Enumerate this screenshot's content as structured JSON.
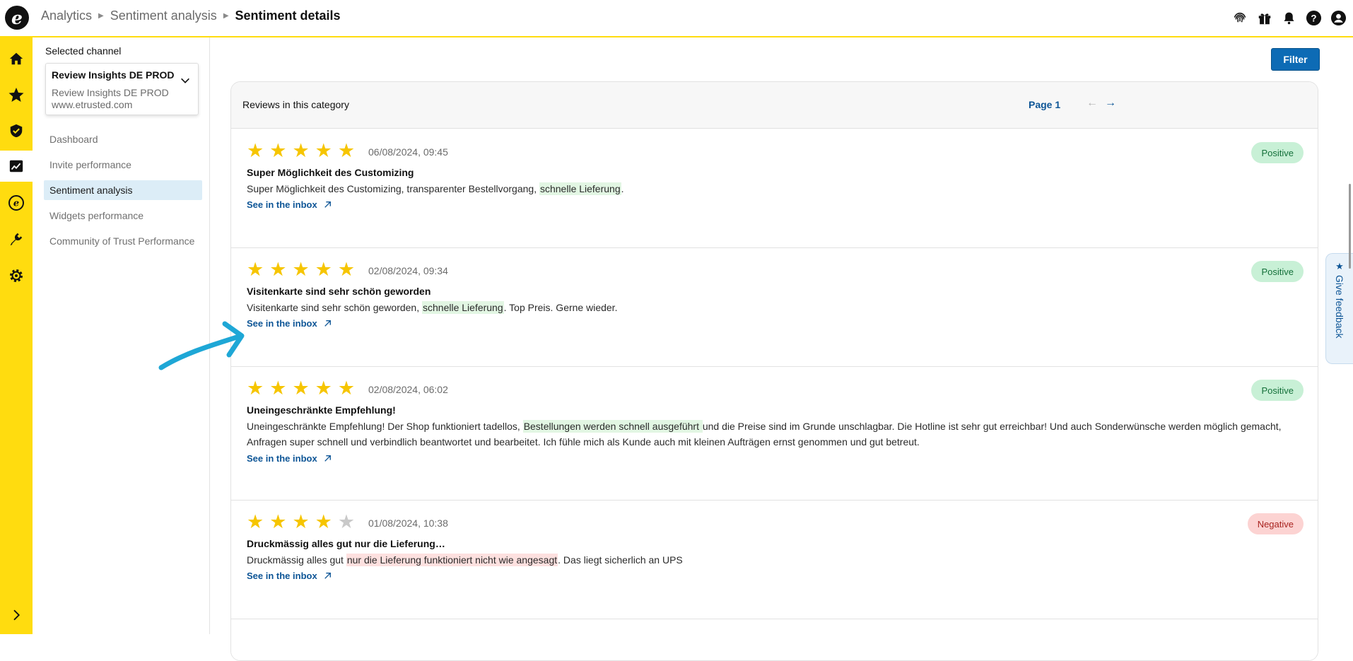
{
  "header": {
    "logo_letter": "e",
    "breadcrumb": [
      "Analytics",
      "Sentiment analysis",
      "Sentiment details"
    ],
    "icons": [
      "fingerprint-icon",
      "gift-icon",
      "bell-icon",
      "help-icon",
      "user-icon"
    ]
  },
  "rail": {
    "icons": [
      "home-icon",
      "star-icon",
      "shield-check-icon",
      "analytics-chart-icon",
      "etrusted-logo-icon",
      "plug-icon",
      "gear-icon"
    ],
    "active": "analytics-chart-icon",
    "expand_icon": "chevron-right-icon"
  },
  "sidebar": {
    "selected_channel_label": "Selected channel",
    "channel": {
      "name": "Review Insights DE PROD",
      "sub_name": "Review Insights DE PROD",
      "domain": "www.etrusted.com"
    },
    "nav": [
      {
        "label": "Dashboard"
      },
      {
        "label": "Invite performance"
      },
      {
        "label": "Sentiment analysis",
        "active": true
      },
      {
        "label": "Widgets performance"
      },
      {
        "label": "Community of Trust Performance"
      }
    ]
  },
  "main": {
    "filter_label": "Filter",
    "card_title": "Reviews in this category",
    "page_label": "Page 1",
    "prev_arrow": "←",
    "next_arrow": "→",
    "link_label": "See in the inbox",
    "reviews": [
      {
        "rating": 5,
        "date": "06/08/2024, 09:45",
        "title": "Super Möglichkeit des Customizing",
        "body_before": "Super Möglichkeit des Customizing, transparenter Bestellvorgang, ",
        "highlight": "schnelle Lieferung",
        "body_after": ".",
        "sentiment": "Positive"
      },
      {
        "rating": 5,
        "date": "02/08/2024, 09:34",
        "title": "Visitenkarte sind sehr schön geworden",
        "body_before": "Visitenkarte sind sehr schön geworden, ",
        "highlight": "schnelle Lieferung",
        "body_after": ". Top Preis. Gerne wieder.",
        "sentiment": "Positive"
      },
      {
        "rating": 5,
        "date": "02/08/2024, 06:02",
        "title": "Uneingeschränkte Empfehlung!",
        "body_before": "Uneingeschränkte Empfehlung! Der Shop funktioniert tadellos, ",
        "highlight": "Bestellungen werden schnell ausgeführt ",
        "body_after": " und die Preise sind im Grunde unschlagbar. Die Hotline ist sehr gut erreichbar! Und auch Sonderwünsche werden möglich gemacht, Anfragen super schnell und verbindlich beantwortet und bearbeitet. Ich fühle mich als Kunde auch mit kleinen Aufträgen ernst genommen und gut betreut.",
        "sentiment": "Positive"
      },
      {
        "rating": 4,
        "date": "01/08/2024, 10:38",
        "title": "Druckmässig alles gut nur die Lieferung…",
        "body_before": "Druckmässig alles gut ",
        "highlight": "nur die Lieferung funktioniert nicht wie angesagt",
        "body_after": ". Das liegt sicherlich an UPS",
        "sentiment": "Negative"
      }
    ]
  },
  "feedback": {
    "label": "Give feedback",
    "icon": "star-icon"
  },
  "colors": {
    "brand_yellow": "#ffdc0f",
    "link_blue": "#0d5596",
    "button_blue": "#0d6bb5",
    "positive_bg": "#c8f0d6",
    "negative_bg": "#fcd3d2",
    "annotation_arrow": "#1ea7d6"
  }
}
